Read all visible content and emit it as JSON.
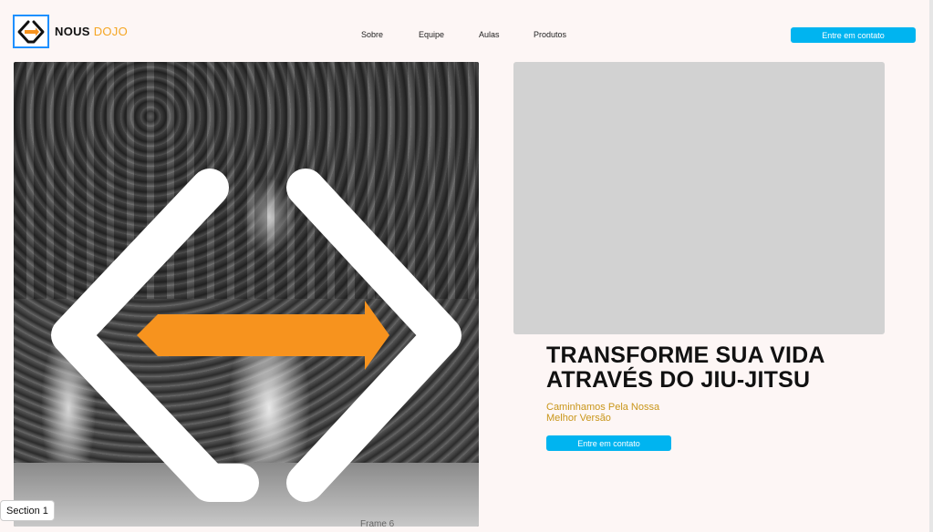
{
  "header": {
    "brand_part1": "NOUS",
    "brand_part2": "DOJO",
    "nav": [
      "Sobre",
      "Equipe",
      "Aulas",
      "Produtos"
    ],
    "cta_label": "Entre em contato"
  },
  "hero": {
    "headline_line1": "TRANSFORME SUA VIDA",
    "headline_line2": "ATRAVÉS DO JIU-JITSU",
    "subhead_line1": "Caminhamos Pela Nossa",
    "subhead_line2": "Melhor Versão",
    "cta_label": "Entre em contato",
    "photo_caption": "Frame 6"
  },
  "section_label": "Section 1",
  "colors": {
    "accent_blue": "#00b4f0",
    "brand_orange": "#f5a623",
    "arrow_orange": "#f7931e",
    "subhead_gold": "#c9961a",
    "page_bg": "#fdf6f5",
    "placeholder_gray": "#d2d2d2"
  },
  "icons": [
    "logo-mark-icon",
    "arrow-right-icon"
  ]
}
